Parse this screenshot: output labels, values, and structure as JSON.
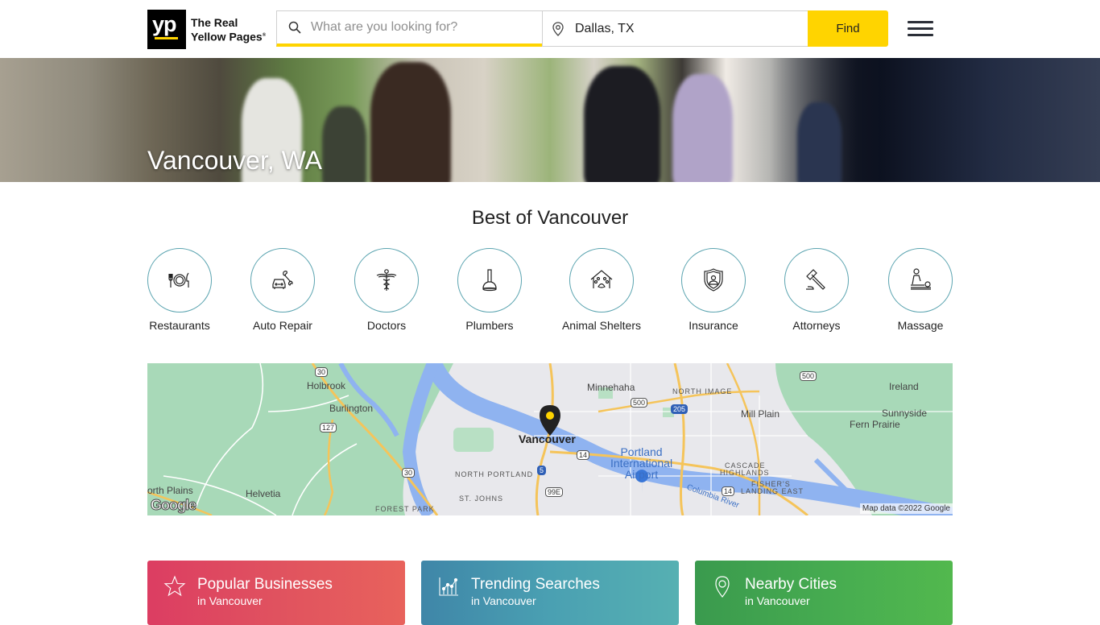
{
  "header": {
    "logo_mark": "yp",
    "logo_line1": "The Real",
    "logo_line2": "Yellow Pages",
    "logo_trademark": "®",
    "search_placeholder": "What are you looking for?",
    "search_value": "",
    "location_value": "Dallas, TX",
    "find_label": "Find",
    "colors": {
      "accent": "#ffd400",
      "logo_bg": "#000000"
    }
  },
  "hero": {
    "title": "Vancouver, WA"
  },
  "best_of": {
    "title": "Best of Vancouver",
    "categories": [
      {
        "label": "Restaurants",
        "icon": "utensils-plate-icon"
      },
      {
        "label": "Auto Repair",
        "icon": "car-wrench-icon"
      },
      {
        "label": "Doctors",
        "icon": "caduceus-icon"
      },
      {
        "label": "Plumbers",
        "icon": "plunger-icon"
      },
      {
        "label": "Animal Shelters",
        "icon": "house-paw-icon"
      },
      {
        "label": "Insurance",
        "icon": "shield-person-icon"
      },
      {
        "label": "Attorneys",
        "icon": "gavel-icon"
      },
      {
        "label": "Massage",
        "icon": "massage-icon"
      }
    ],
    "circle_color": "#5ba4b0"
  },
  "map": {
    "center_label": "Vancouver",
    "places": [
      "Holbrook",
      "Burlington",
      "Minnehaha",
      "Mill Plain",
      "Ireland",
      "Sunnyside",
      "Fern Prairie",
      "Helvetia",
      "orth Plains"
    ],
    "districts": [
      "NORTH IMAGE",
      "NORTH PORTLAND",
      "ST. JOHNS",
      "FOREST PARK",
      "CASCADE",
      "HIGHLANDS",
      "FISHER'S",
      "LANDING EAST"
    ],
    "airport": [
      "Portland",
      "International",
      "Airport"
    ],
    "river": "Columbia River",
    "routes": [
      "30",
      "127",
      "30",
      "500",
      "205",
      "14",
      "5",
      "99E",
      "500",
      "14"
    ],
    "google_logo": "Google",
    "attribution": "Map data ©2022 Google"
  },
  "cards": [
    {
      "title": "Popular Businesses",
      "subtitle": "in Vancouver",
      "icon": "star-icon",
      "color": "#dc3d62"
    },
    {
      "title": "Trending Searches",
      "subtitle": "in Vancouver",
      "icon": "trend-chart-icon",
      "color": "#3f86a8"
    },
    {
      "title": "Nearby Cities",
      "subtitle": "in Vancouver",
      "icon": "location-pin-icon",
      "color": "#3a9a4e"
    }
  ]
}
